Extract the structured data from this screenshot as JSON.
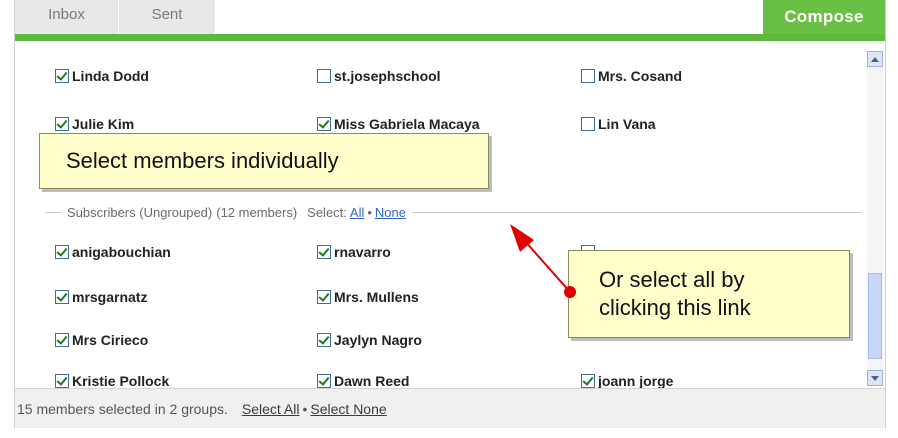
{
  "tabs": {
    "inbox": "Inbox",
    "sent": "Sent",
    "compose": "Compose"
  },
  "grouped_rows": [
    [
      {
        "name": "Linda Dodd",
        "checked": true
      },
      {
        "name": "st.josephschool",
        "checked": false
      },
      {
        "name": "Mrs. Cosand",
        "checked": false
      }
    ],
    [
      {
        "name": "Julie Kim",
        "checked": true
      },
      {
        "name": "Miss Gabriela Macaya",
        "checked": true
      },
      {
        "name": "Lin Vana",
        "checked": false
      }
    ]
  ],
  "section": {
    "title": "Subscribers (Ungrouped)",
    "count": "(12 members)",
    "select_label": "Select:",
    "all_link": "All",
    "none_link": "None"
  },
  "subscriber_rows": [
    [
      {
        "name": "anigabouchian",
        "checked": true
      },
      {
        "name": "rnavarro",
        "checked": true
      }
    ],
    [
      {
        "name": "mrsgarnatz",
        "checked": true
      },
      {
        "name": "Mrs. Mullens",
        "checked": true
      }
    ],
    [
      {
        "name": "Mrs Cirieco",
        "checked": true
      },
      {
        "name": "Jaylyn Nagro",
        "checked": true
      }
    ],
    [
      {
        "name": "Kristie Pollock",
        "checked": true
      },
      {
        "name": "Dawn Reed",
        "checked": true
      },
      {
        "name": "joann jorge",
        "checked": true
      }
    ]
  ],
  "footer": {
    "status": "15 members selected in 2 groups.",
    "select_all": "Select All",
    "select_none": "Select None"
  },
  "callouts": {
    "individual": "Select members individually",
    "all_line1": "Or select all by",
    "all_line2": "clicking this link"
  },
  "colors": {
    "compose_green": "#6abf45",
    "callout_bg": "#ffffcc",
    "link_blue": "#3366cc",
    "arrow_red": "#e00000"
  }
}
